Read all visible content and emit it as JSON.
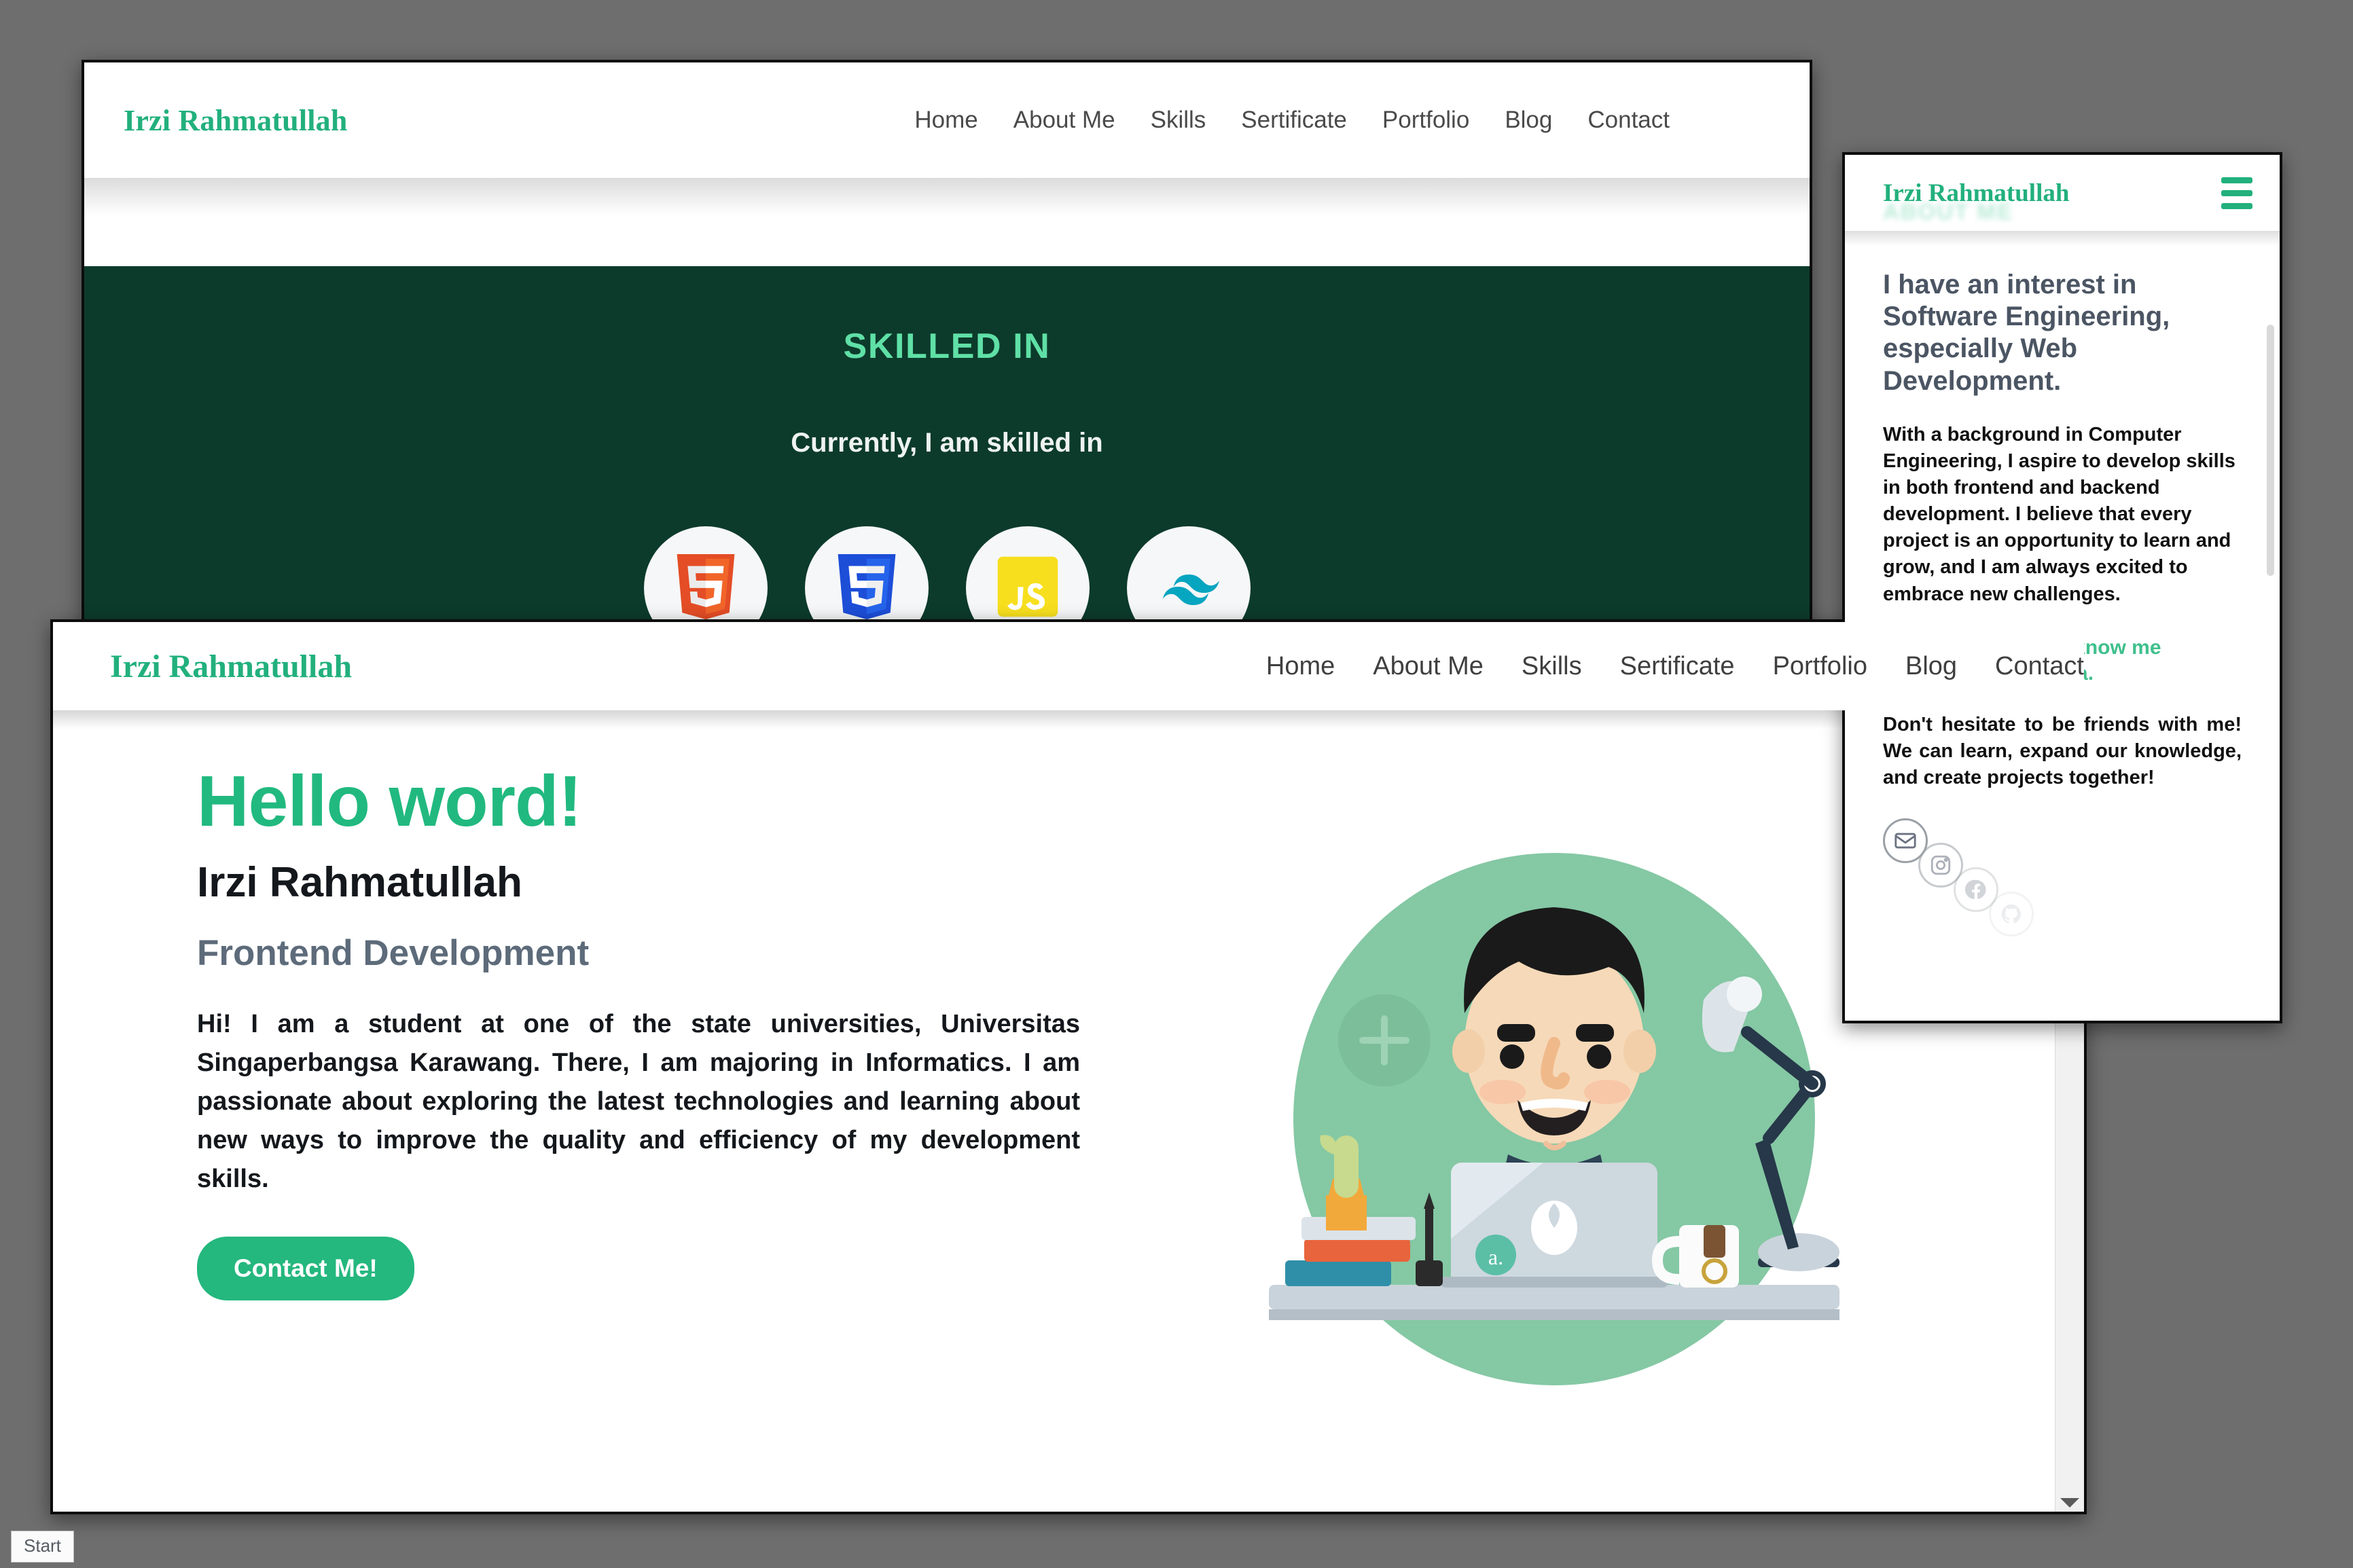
{
  "back_window": {
    "brand": "Irzi Rahmatullah",
    "nav": [
      {
        "label": "Home"
      },
      {
        "label": "About Me"
      },
      {
        "label": "Skills"
      },
      {
        "label": "Sertificate"
      },
      {
        "label": "Portfolio"
      },
      {
        "label": "Blog"
      },
      {
        "label": "Contact"
      }
    ],
    "skills_section": {
      "title": "SKILLED IN",
      "subtitle": "Currently, I am skilled in",
      "background_color": "#0c3b2b",
      "title_color": "#5fe0a6",
      "skills": [
        {
          "name": "HTML5",
          "icon": "html5-icon",
          "color": "#E44D26"
        },
        {
          "name": "CSS3",
          "icon": "css3-icon",
          "color": "#1D4ED8"
        },
        {
          "name": "JavaScript",
          "icon": "javascript-icon",
          "color": "#F7DF1E"
        },
        {
          "name": "Tailwind CSS",
          "icon": "tailwind-icon",
          "color": "#06A5C0"
        }
      ]
    }
  },
  "about_panel": {
    "brand": "Irzi Rahmatullah",
    "ghost_heading": "ABOUT ME",
    "menu_icon": "hamburger-icon",
    "lead": "I have an interest in Software Engineering, especially Web Development.",
    "paragraph": "With a background in Computer Engineering, I aspire to develop skills in both frontend and backend development. I believe that every project is an opportunity to learn and grow, and I am always excited to embrace new challenges.",
    "accent": "You can also get to know me through social media.",
    "closing": "Don't hesitate to be friends with me! We can learn, expand our knowledge, and create projects together!",
    "accent_color": "#3fc08c",
    "socials": [
      {
        "name": "email-icon",
        "label": "Email"
      },
      {
        "name": "instagram-icon",
        "label": "Instagram"
      },
      {
        "name": "facebook-icon",
        "label": "Facebook"
      },
      {
        "name": "github-icon",
        "label": "GitHub"
      }
    ]
  },
  "front_window": {
    "brand": "Irzi Rahmatullah",
    "nav": [
      {
        "label": "Home"
      },
      {
        "label": "About Me"
      },
      {
        "label": "Skills"
      },
      {
        "label": "Sertificate"
      },
      {
        "label": "Portfolio"
      },
      {
        "label": "Blog"
      },
      {
        "label": "Contact"
      }
    ],
    "hero": {
      "greeting": "Hello word!",
      "name": "Irzi Rahmatullah",
      "role": "Frontend Development",
      "description": "Hi! I am a student at one of the state universities, Universitas Singaperbangsa Karawang. There, I am majoring in Informatics. I am passionate about exploring the latest technologies and learning about new ways to improve the quality and efficiency of my development skills.",
      "cta_label": "Contact Me!",
      "cta_color": "#24b77e",
      "greeting_color": "#21b97f",
      "illustration": "developer-at-desk-illustration"
    }
  },
  "taskbar": {
    "start_label": "Start"
  }
}
